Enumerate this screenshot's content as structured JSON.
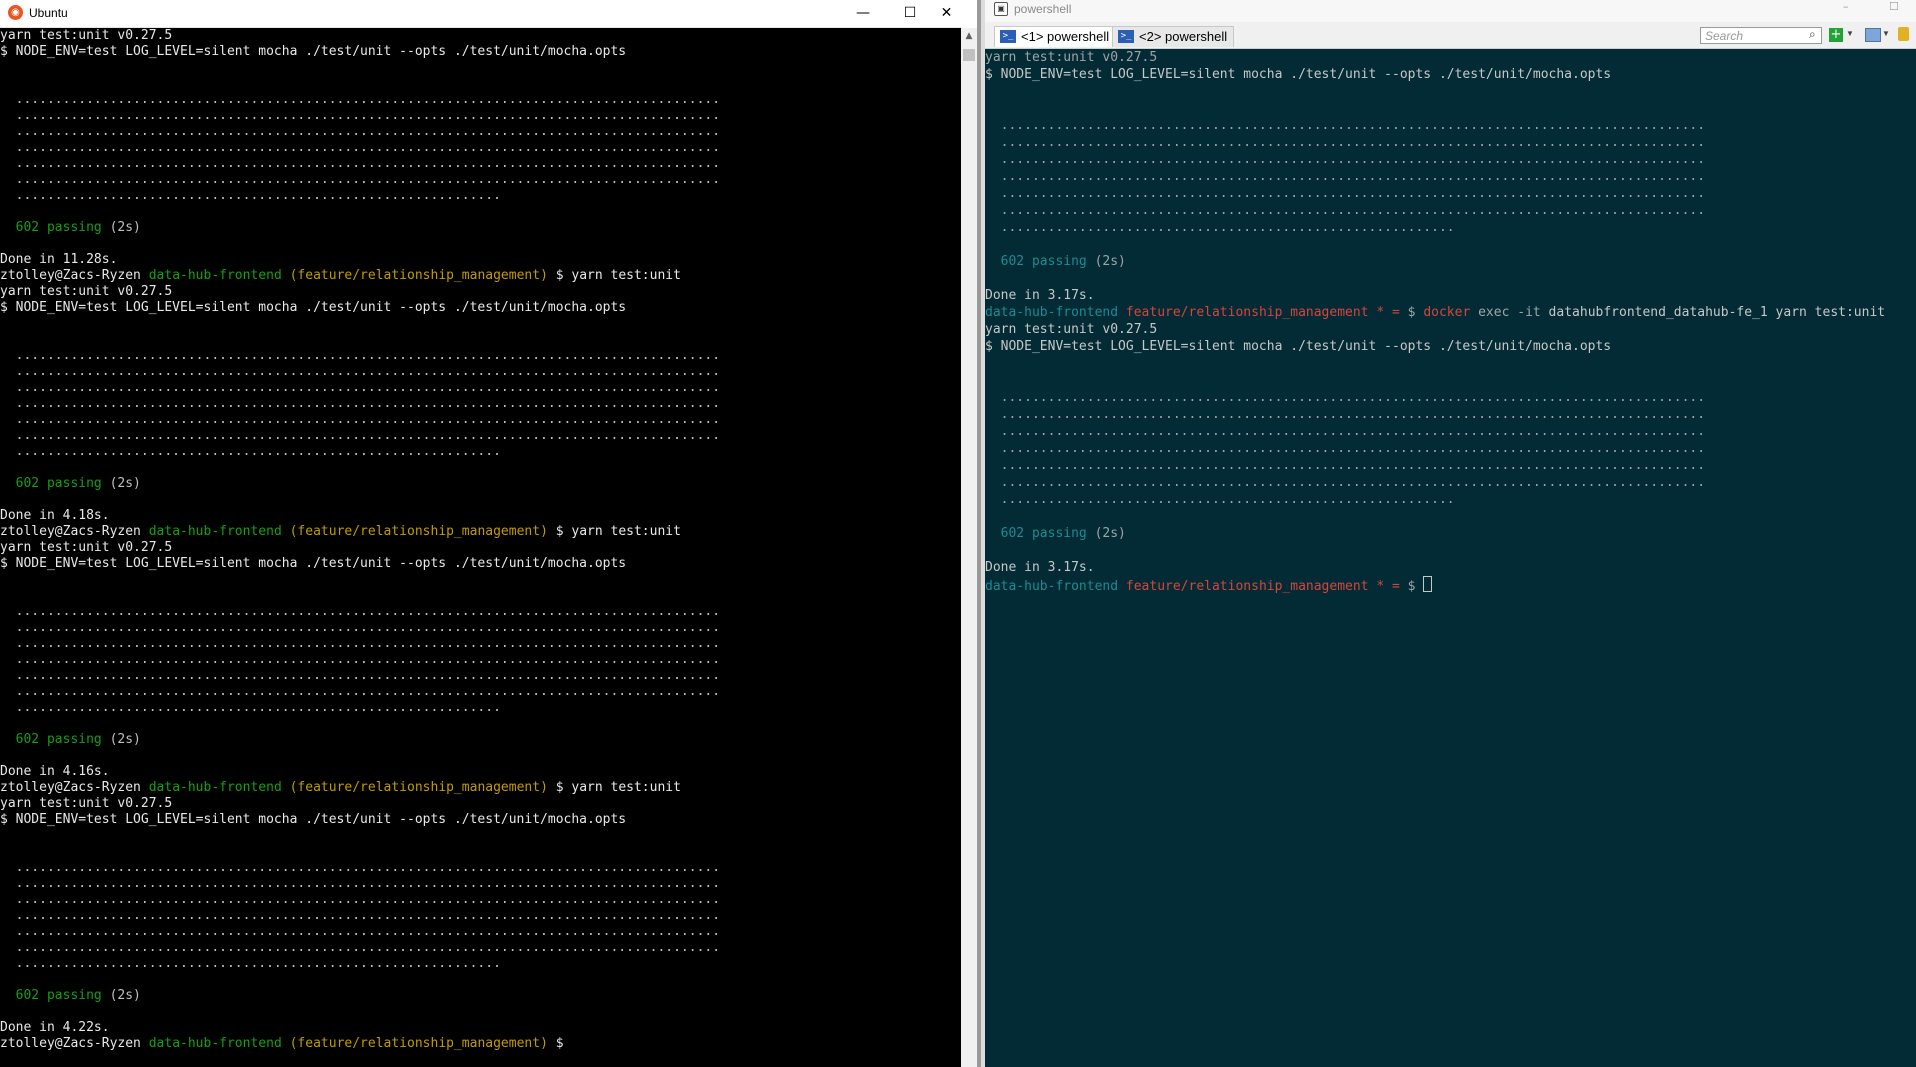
{
  "ubuntu": {
    "title": "Ubuntu",
    "controls": {
      "minimize": "—",
      "maximize": "☐",
      "close": "✕"
    },
    "lines": [
      {
        "t": "yarn test:unit v0.27.5",
        "c": "white"
      },
      {
        "t": "$ NODE_ENV=test LOG_LEVEL=silent mocha ./test/unit --opts ./test/unit/mocha.opts",
        "c": "white"
      },
      {
        "t": ""
      },
      {
        "t": ""
      },
      {
        "t": "  ..........................................................................................",
        "c": "dots"
      },
      {
        "t": "  ..........................................................................................",
        "c": "dots"
      },
      {
        "t": "  ..........................................................................................",
        "c": "dots"
      },
      {
        "t": "  ..........................................................................................",
        "c": "dots"
      },
      {
        "t": "  ..........................................................................................",
        "c": "dots"
      },
      {
        "t": "  ..........................................................................................",
        "c": "dots"
      },
      {
        "t": "  ..............................................................",
        "c": "dots"
      },
      {
        "t": ""
      },
      {
        "pass": "602 passing",
        "time": "(2s)"
      },
      {
        "t": ""
      },
      {
        "t": "Done in 11.28s.",
        "c": "white"
      },
      {
        "prompt": true,
        "user": "ztolley@Zacs-Ryzen",
        "dir": "data-hub-frontend",
        "branch": "(feature/relationship_management)",
        "cmd": "$ yarn test:unit"
      },
      {
        "t": "yarn test:unit v0.27.5",
        "c": "white"
      },
      {
        "t": "$ NODE_ENV=test LOG_LEVEL=silent mocha ./test/unit --opts ./test/unit/mocha.opts",
        "c": "white"
      },
      {
        "t": ""
      },
      {
        "t": ""
      },
      {
        "t": "  ..........................................................................................",
        "c": "dots"
      },
      {
        "t": "  ..........................................................................................",
        "c": "dots"
      },
      {
        "t": "  ..........................................................................................",
        "c": "dots"
      },
      {
        "t": "  ..........................................................................................",
        "c": "dots"
      },
      {
        "t": "  ..........................................................................................",
        "c": "dots"
      },
      {
        "t": "  ..........................................................................................",
        "c": "dots"
      },
      {
        "t": "  ..............................................................",
        "c": "dots"
      },
      {
        "t": ""
      },
      {
        "pass": "602 passing",
        "time": "(2s)"
      },
      {
        "t": ""
      },
      {
        "t": "Done in 4.18s.",
        "c": "white"
      },
      {
        "prompt": true,
        "user": "ztolley@Zacs-Ryzen",
        "dir": "data-hub-frontend",
        "branch": "(feature/relationship_management)",
        "cmd": "$ yarn test:unit"
      },
      {
        "t": "yarn test:unit v0.27.5",
        "c": "white"
      },
      {
        "t": "$ NODE_ENV=test LOG_LEVEL=silent mocha ./test/unit --opts ./test/unit/mocha.opts",
        "c": "white"
      },
      {
        "t": ""
      },
      {
        "t": ""
      },
      {
        "t": "  ..........................................................................................",
        "c": "dots"
      },
      {
        "t": "  ..........................................................................................",
        "c": "dots"
      },
      {
        "t": "  ..........................................................................................",
        "c": "dots"
      },
      {
        "t": "  ..........................................................................................",
        "c": "dots"
      },
      {
        "t": "  ..........................................................................................",
        "c": "dots"
      },
      {
        "t": "  ..........................................................................................",
        "c": "dots"
      },
      {
        "t": "  ..............................................................",
        "c": "dots"
      },
      {
        "t": ""
      },
      {
        "pass": "602 passing",
        "time": "(2s)"
      },
      {
        "t": ""
      },
      {
        "t": "Done in 4.16s.",
        "c": "white"
      },
      {
        "prompt": true,
        "user": "ztolley@Zacs-Ryzen",
        "dir": "data-hub-frontend",
        "branch": "(feature/relationship_management)",
        "cmd": "$ yarn test:unit"
      },
      {
        "t": "yarn test:unit v0.27.5",
        "c": "white"
      },
      {
        "t": "$ NODE_ENV=test LOG_LEVEL=silent mocha ./test/unit --opts ./test/unit/mocha.opts",
        "c": "white"
      },
      {
        "t": ""
      },
      {
        "t": ""
      },
      {
        "t": "  ..........................................................................................",
        "c": "dots"
      },
      {
        "t": "  ..........................................................................................",
        "c": "dots"
      },
      {
        "t": "  ..........................................................................................",
        "c": "dots"
      },
      {
        "t": "  ..........................................................................................",
        "c": "dots"
      },
      {
        "t": "  ..........................................................................................",
        "c": "dots"
      },
      {
        "t": "  ..........................................................................................",
        "c": "dots"
      },
      {
        "t": "  ..............................................................",
        "c": "dots"
      },
      {
        "t": ""
      },
      {
        "pass": "602 passing",
        "time": "(2s)"
      },
      {
        "t": ""
      },
      {
        "t": "Done in 4.22s.",
        "c": "white"
      },
      {
        "prompt": true,
        "user": "ztolley@Zacs-Ryzen",
        "dir": "data-hub-frontend",
        "branch": "(feature/relationship_management)",
        "cmd": "$"
      }
    ]
  },
  "powershell": {
    "title": "powershell",
    "tabs": [
      {
        "label": "<1> powershell",
        "active": true
      },
      {
        "label": "<2> powershell",
        "active": false
      }
    ],
    "search_placeholder": "Search",
    "lines": [
      {
        "t": "yarn test:unit v0.27.5",
        "c": "dim"
      },
      {
        "t": "$ NODE_ENV=test LOG_LEVEL=silent mocha ./test/unit --opts ./test/unit/mocha.opts"
      },
      {
        "t": ""
      },
      {
        "t": ""
      },
      {
        "t": "  ..........................................................................................",
        "c": "dim"
      },
      {
        "t": "  ..........................................................................................",
        "c": "dim"
      },
      {
        "t": "  ..........................................................................................",
        "c": "dim"
      },
      {
        "t": "  ..........................................................................................",
        "c": "dim"
      },
      {
        "t": "  ..........................................................................................",
        "c": "dim"
      },
      {
        "t": "  ..........................................................................................",
        "c": "dim"
      },
      {
        "t": "  ..........................................................",
        "c": "dim"
      },
      {
        "t": ""
      },
      {
        "pass": "602 passing",
        "time": "(2s)"
      },
      {
        "t": ""
      },
      {
        "t": "Done in 3.17s."
      },
      {
        "prompt": true,
        "dir": "data-hub-frontend",
        "branch": "feature/relationship_management * =",
        "dollar": "$",
        "cmd": "docker",
        "opt": " exec -it",
        "rest": " datahubfrontend_datahub-fe_1 yarn test:unit"
      },
      {
        "t": "yarn test:unit v0.27.5"
      },
      {
        "t": "$ NODE_ENV=test LOG_LEVEL=silent mocha ./test/unit --opts ./test/unit/mocha.opts"
      },
      {
        "t": ""
      },
      {
        "t": ""
      },
      {
        "t": "  ..........................................................................................",
        "c": "dim"
      },
      {
        "t": "  ..........................................................................................",
        "c": "dim"
      },
      {
        "t": "  ..........................................................................................",
        "c": "dim"
      },
      {
        "t": "  ..........................................................................................",
        "c": "dim"
      },
      {
        "t": "  ..........................................................................................",
        "c": "dim"
      },
      {
        "t": "  ..........................................................................................",
        "c": "dim"
      },
      {
        "t": "  ..........................................................",
        "c": "dim"
      },
      {
        "t": ""
      },
      {
        "pass": "602 passing",
        "time": "(2s)"
      },
      {
        "t": ""
      },
      {
        "t": "Done in 3.17s."
      },
      {
        "prompt": true,
        "dir": "data-hub-frontend",
        "branch": "feature/relationship_management * =",
        "dollar": "$",
        "cursor": true
      }
    ]
  },
  "colors": {
    "ubuntu_bg": "#000000",
    "ubuntu_green": "#13a10e",
    "ubuntu_olive": "#c19c00",
    "ps_bg": "#022b35",
    "ps_teal": "#1c8b94",
    "ps_red": "#d5453d"
  }
}
